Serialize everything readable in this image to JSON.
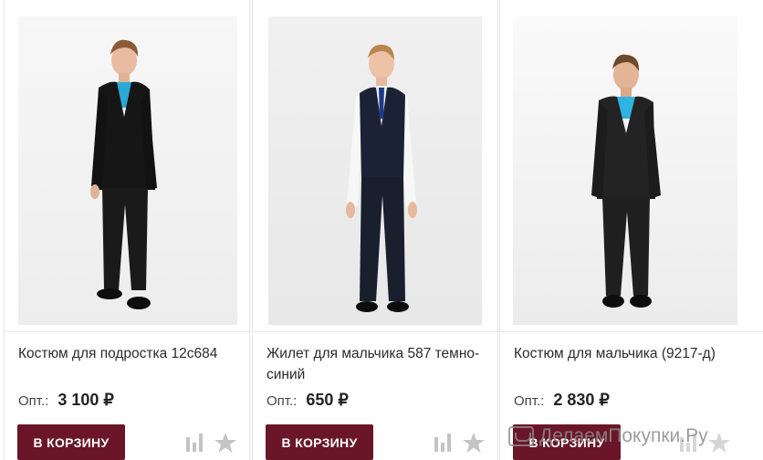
{
  "products": [
    {
      "title": "Костюм для подростка 12с684",
      "price_label": "Опт.:",
      "price": "3 100 ₽",
      "cart_label": "В КОРЗИНУ",
      "image_icon": "boy-in-black-suit-photo"
    },
    {
      "title": "Жилет для мальчика 587 темно-синий",
      "price_label": "Опт.:",
      "price": "650 ₽",
      "cart_label": "В КОРЗИНУ",
      "image_icon": "boy-in-navy-vest-photo"
    },
    {
      "title": "Костюм для мальчика (9217-д)",
      "price_label": "Опт.:",
      "price": "2 830 ₽",
      "cart_label": "В КОРЗИНУ",
      "image_icon": "boy-in-dark-suit-photo"
    }
  ],
  "icons": {
    "compare": "bar-chart-icon",
    "favorite": "star-icon"
  },
  "watermark": "ДелаемПокупки.Ру",
  "colors": {
    "cart_button": "#6b1628",
    "icon_gray": "#c4c4c4",
    "border": "#e6e6e6"
  }
}
